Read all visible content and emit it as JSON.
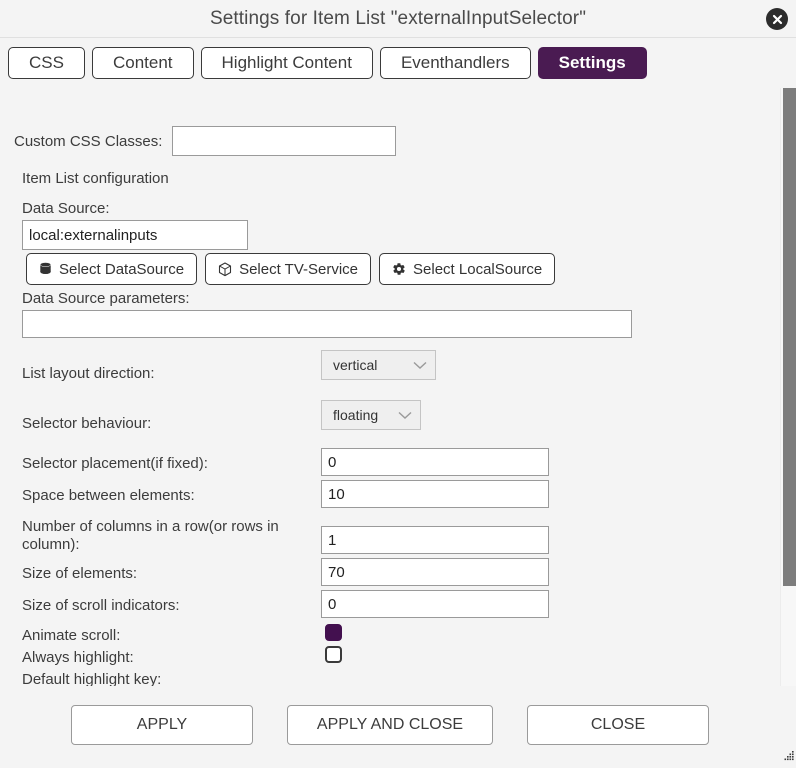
{
  "window": {
    "title": "Settings for Item List \"externalInputSelector\"",
    "close_icon": "close-circle-icon"
  },
  "tabs": [
    {
      "label": "CSS",
      "active": false
    },
    {
      "label": "Content",
      "active": false
    },
    {
      "label": "Highlight Content",
      "active": false
    },
    {
      "label": "Eventhandlers",
      "active": false
    },
    {
      "label": "Settings",
      "active": true
    }
  ],
  "form": {
    "custom_css_label": "Custom CSS Classes:",
    "custom_css_value": "",
    "section_title": "Item List configuration",
    "data_source_label": "Data Source:",
    "data_source_value": "local:externalinputs",
    "source_buttons": [
      {
        "label": "Select DataSource",
        "icon": "database-icon"
      },
      {
        "label": "Select TV-Service",
        "icon": "cube-icon"
      },
      {
        "label": "Select LocalSource",
        "icon": "gear-icon"
      }
    ],
    "params_label": "Data Source parameters:",
    "params_value": "",
    "layout_direction_label": "List layout direction:",
    "layout_direction_value": "vertical",
    "selector_behaviour_label": "Selector behaviour:",
    "selector_behaviour_value": "floating",
    "selector_placement_label": "Selector placement(if fixed):",
    "selector_placement_value": "0",
    "space_between_label": "Space between elements:",
    "space_between_value": "10",
    "columns_label": "Number of columns in a row(or rows in column):",
    "columns_value": "1",
    "size_elements_label": "Size of elements:",
    "size_elements_value": "70",
    "size_scroll_label": "Size of scroll indicators:",
    "size_scroll_value": "0",
    "animate_scroll_label": "Animate scroll:",
    "animate_scroll_checked": true,
    "always_highlight_label": "Always highlight:",
    "always_highlight_checked": false,
    "default_highlight_label": "Default highlight key:"
  },
  "footer": {
    "apply_label": "APPLY",
    "apply_close_label": "APPLY AND CLOSE",
    "close_label": "CLOSE"
  },
  "colors": {
    "accent": "#4a1b52",
    "checkbox_on": "#43104f",
    "page_bg": "#f4f4f4",
    "scrollbar_thumb": "#7d7d7d"
  }
}
